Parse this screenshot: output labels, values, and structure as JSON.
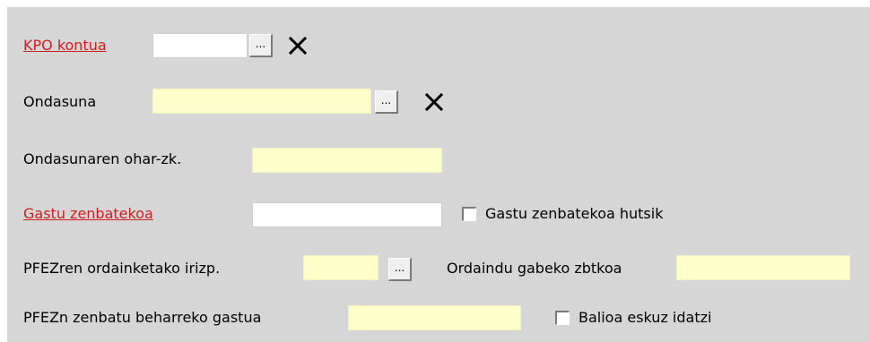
{
  "form": {
    "kpo_kontua": {
      "label": "KPO kontua",
      "value": "",
      "browse": "...",
      "clear_icon": "close-x"
    },
    "ondasuna": {
      "label": "Ondasuna",
      "value": "",
      "browse": "...",
      "clear_icon": "close-x"
    },
    "ondasunaren_ohar": {
      "label": "Ondasunaren ohar-zk.",
      "value": ""
    },
    "gastu_zenbatekoa": {
      "label": "Gastu zenbatekoa",
      "value": "",
      "checkbox_label": "Gastu zenbatekoa hutsik",
      "checked": false
    },
    "pfez_ordainketa": {
      "label": "PFEZren ordainketako irizp.",
      "value": "",
      "browse": "...",
      "unpaid_label": "Ordaindu gabeko zbtkoa",
      "unpaid_value": ""
    },
    "pfez_zenbatu": {
      "label": "PFEZn zenbatu beharreko gastua",
      "value": "",
      "checkbox_label": "Balioa eskuz idatzi",
      "checked": false
    }
  },
  "colors": {
    "panel": "#d6d6d6",
    "required_label": "#cc1f1f",
    "readonly_field": "#ffffcc",
    "editable_field": "#ffffff"
  }
}
